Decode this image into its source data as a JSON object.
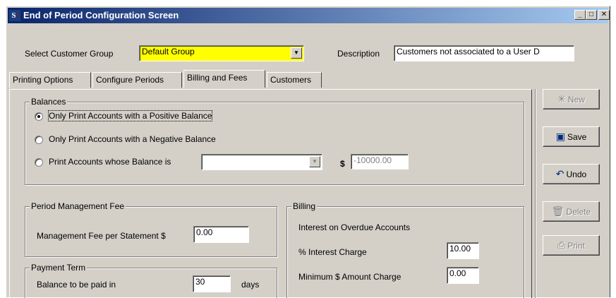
{
  "window": {
    "title": "End of Period Configuration Screen",
    "icon": "sf-app-icon",
    "icon_text": "S",
    "icon_slash": "/",
    "minimize": "_",
    "maximize": "□",
    "close": "✕"
  },
  "top": {
    "customer_group_label": "Select Customer Group",
    "customer_group_value": "Default Group",
    "customer_group_color": "#ffff00",
    "description_label": "Description",
    "description_value": "Customers not associated to a User D"
  },
  "tabs": [
    {
      "label": "Printing Options",
      "active": false
    },
    {
      "label": "Configure Periods",
      "active": false
    },
    {
      "label": "Billing and Fees",
      "active": true
    },
    {
      "label": "Customers",
      "active": false
    }
  ],
  "balances": {
    "title": "Balances",
    "options": [
      {
        "label": "Only Print Accounts with a Positive Balance",
        "selected": true
      },
      {
        "label": "Only Print Accounts with a Negative Balance",
        "selected": false
      },
      {
        "label": "Print Accounts whose Balance is",
        "selected": false
      }
    ],
    "balance_condition_value": "",
    "dollar_sign": "$",
    "amount_value": "-10000.00"
  },
  "period_fee": {
    "title": "Period Management Fee",
    "label": "Management Fee per Statement $",
    "value": "0.00"
  },
  "payment_term": {
    "title": "Payment Term",
    "label": "Balance to be paid in",
    "value": "30",
    "unit": "days"
  },
  "billing": {
    "title": "Billing",
    "interest_heading": "Interest on Overdue Accounts",
    "interest_label": "% Interest Charge",
    "interest_value": "10.00",
    "min_label": "Minimum $ Amount Charge",
    "min_value": "0.00"
  },
  "buttons": {
    "new": "New",
    "save": "Save",
    "undo": "Undo",
    "delete": "Delete",
    "print": "Print"
  }
}
